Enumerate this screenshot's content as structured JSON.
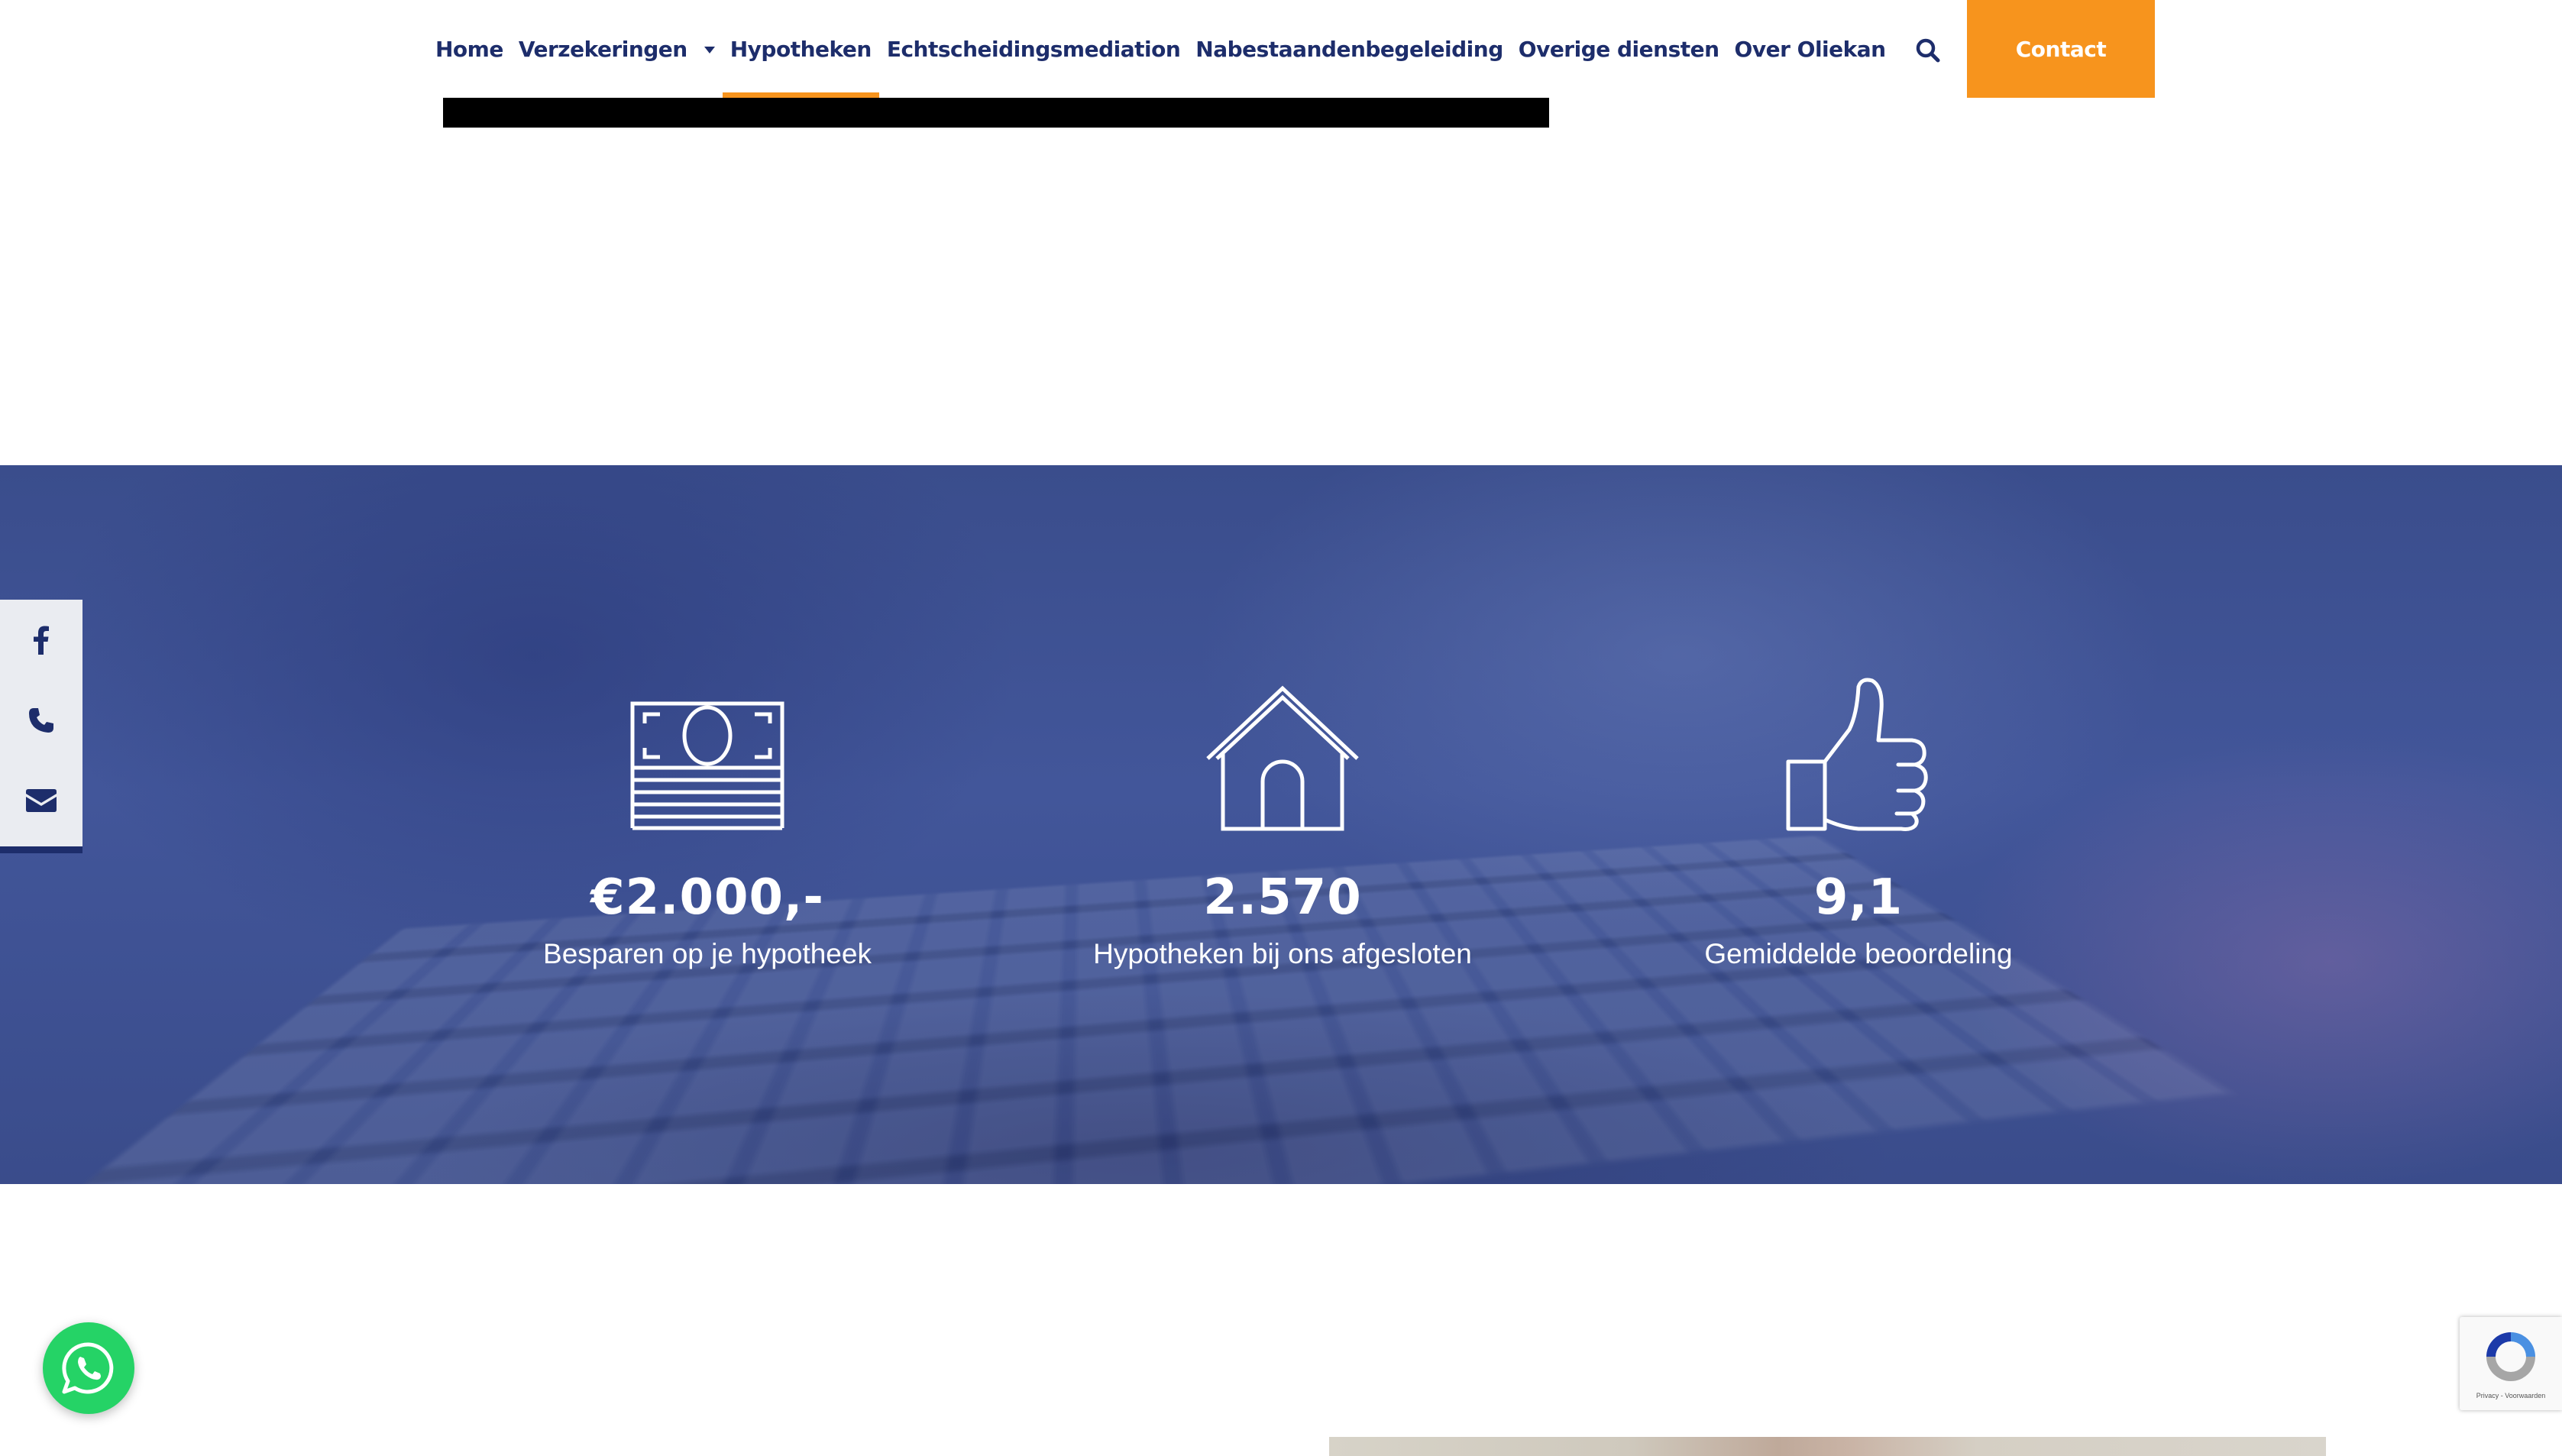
{
  "nav": {
    "items": [
      {
        "label": "Home"
      },
      {
        "label": "Verzekeringen",
        "has_dropdown": true
      },
      {
        "label": "Hypotheken",
        "active": true
      },
      {
        "label": "Echtscheidingsmediation"
      },
      {
        "label": "Nabestaandenbegeleiding"
      },
      {
        "label": "Overige diensten"
      },
      {
        "label": "Over Oliekan"
      }
    ],
    "search_icon": "search-icon",
    "contact_label": "Contact"
  },
  "stats": [
    {
      "icon": "money-icon",
      "value": "€2.000,-",
      "label": "Besparen op je hypotheek"
    },
    {
      "icon": "house-icon",
      "value": "2.570",
      "label": "Hypotheken bij ons afgesloten"
    },
    {
      "icon": "thumbs-up-icon",
      "value": "9,1",
      "label": "Gemiddelde beoordeling"
    }
  ],
  "social": [
    "facebook-icon",
    "phone-icon",
    "envelope-icon"
  ],
  "recaptcha": {
    "text": "Privacy - Voorwaarden"
  },
  "colors": {
    "brand": "#1d2d6b",
    "accent": "#f7941d",
    "whatsapp": "#25d366"
  }
}
